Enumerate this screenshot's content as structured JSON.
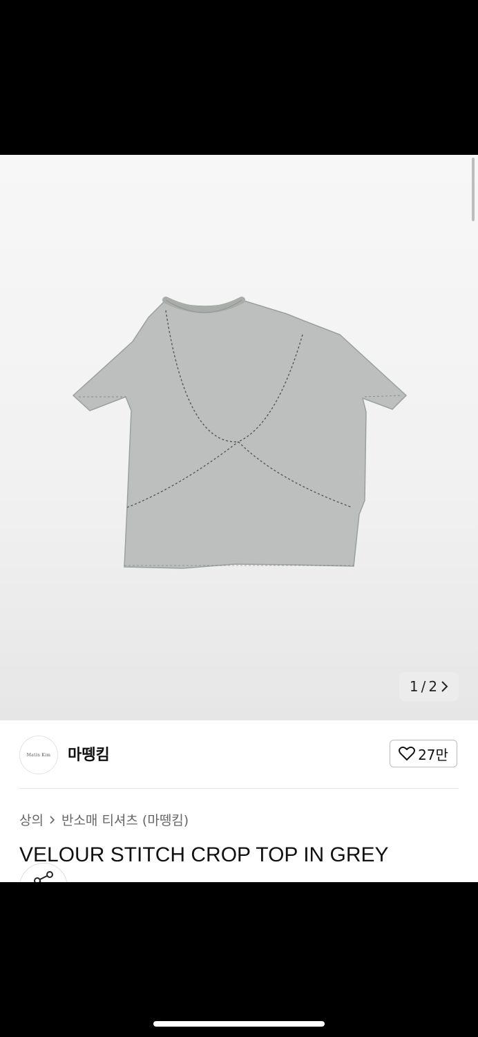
{
  "gallery": {
    "counter_current": "1",
    "counter_sep": "/",
    "counter_total": "2",
    "next_icon": "chevron-right-icon"
  },
  "brand": {
    "logo_text": "Matin Kim",
    "name": "마뗑킴",
    "likes": "27만",
    "like_icon": "heart-outline-icon"
  },
  "breadcrumb": {
    "category": "상의",
    "separator_icon": "chevron-right-icon",
    "subcategory": "반소매 티셔츠 (마뗑킴)"
  },
  "product": {
    "title": "VELOUR STITCH CROP TOP IN GREY"
  },
  "share": {
    "icon": "share-icon"
  },
  "colors": {
    "shirt": "#bcbfbd",
    "stitch": "#555"
  }
}
